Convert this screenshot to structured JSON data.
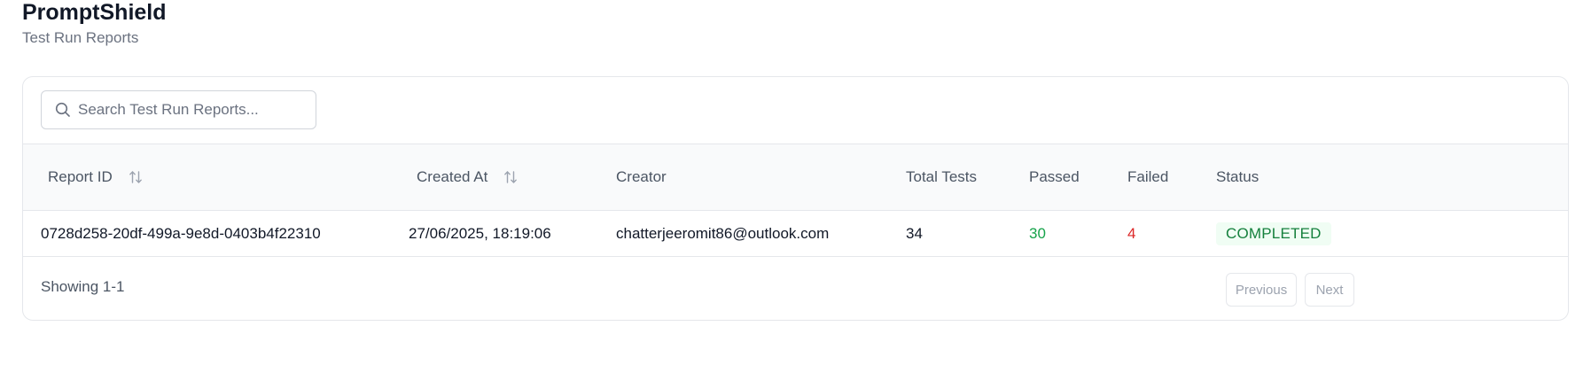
{
  "header": {
    "title": "PromptShield",
    "subtitle": "Test Run Reports"
  },
  "search": {
    "placeholder": "Search Test Run Reports...",
    "value": "",
    "icon": "search-icon"
  },
  "table": {
    "columns": [
      {
        "label": "Report ID",
        "sortable": true
      },
      {
        "label": "Created At",
        "sortable": true
      },
      {
        "label": "Creator",
        "sortable": false
      },
      {
        "label": "Total Tests",
        "sortable": false
      },
      {
        "label": "Passed",
        "sortable": false
      },
      {
        "label": "Failed",
        "sortable": false
      },
      {
        "label": "Status",
        "sortable": false
      }
    ],
    "rows": [
      {
        "report_id": "0728d258-20df-499a-9e8d-0403b4f22310",
        "created_at": "27/06/2025, 18:19:06",
        "creator": "chatterjeeromit86@outlook.com",
        "total_tests": "34",
        "passed": "30",
        "failed": "4",
        "status": "COMPLETED"
      }
    ]
  },
  "pagination": {
    "showing": "Showing 1-1",
    "previous_label": "Previous",
    "next_label": "Next"
  },
  "colors": {
    "passed": "#16a34a",
    "failed": "#dc2626",
    "status_bg": "#f0fdf4",
    "status_text": "#15803d"
  }
}
